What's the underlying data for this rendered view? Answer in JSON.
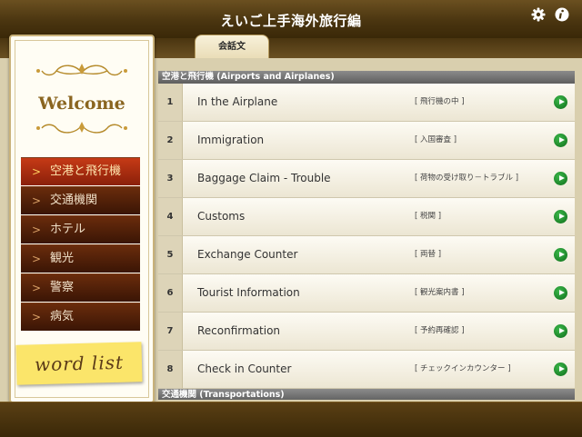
{
  "header": {
    "title": "えいご上手海外旅行編",
    "settings_icon": "gear-icon",
    "info_icon": "info-icon"
  },
  "tabs": [
    {
      "label": "会話文",
      "active": true
    }
  ],
  "sidebar": {
    "welcome": "Welcome",
    "items": [
      {
        "label": "空港と飛行機",
        "active": true
      },
      {
        "label": "交通機関",
        "active": false
      },
      {
        "label": "ホテル",
        "active": false
      },
      {
        "label": "観光",
        "active": false
      },
      {
        "label": "警察",
        "active": false
      },
      {
        "label": "病気",
        "active": false
      }
    ],
    "word_list": "word list"
  },
  "list": {
    "section1": "空港と飛行機 (Airports and Airplanes)",
    "rows": [
      {
        "num": "1",
        "title": "In the Airplane",
        "jp": "[ 飛行機の中 ]"
      },
      {
        "num": "2",
        "title": "Immigration",
        "jp": "[ 入国審査 ]"
      },
      {
        "num": "3",
        "title": "Baggage Claim - Trouble",
        "jp": "[ 荷物の受け取り－トラブル ]"
      },
      {
        "num": "4",
        "title": "Customs",
        "jp": "[ 税関 ]"
      },
      {
        "num": "5",
        "title": "Exchange Counter",
        "jp": "[ 両替 ]"
      },
      {
        "num": "6",
        "title": "Tourist Information",
        "jp": "[ 観光案内書 ]"
      },
      {
        "num": "7",
        "title": "Reconfirmation",
        "jp": "[ 予約再確認 ]"
      },
      {
        "num": "8",
        "title": "Check in Counter",
        "jp": "[ チェックインカウンター ]"
      }
    ],
    "section2": "交通機関 (Transportations)"
  },
  "colors": {
    "bar_brown": "#4a3510",
    "menu_active": "#c63a16",
    "play_green": "#1e8a2a",
    "sticky_yellow": "#fbe56a"
  }
}
